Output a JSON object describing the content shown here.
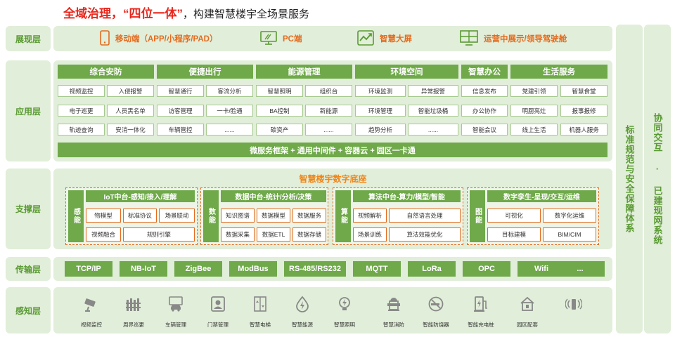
{
  "title": {
    "part1": "全域治理，“四位一体”",
    "part2": "，构建智慧楼宇全场景服务"
  },
  "layers": {
    "display": "展现层",
    "application": "应用层",
    "support": "支撑层",
    "transport": "传输层",
    "perception": "感知层"
  },
  "display": {
    "items": [
      {
        "label": "移动端（APP/小程序/PAD）",
        "icon": "mobile-phone-icon"
      },
      {
        "label": "PC端",
        "icon": "monitor-icon"
      },
      {
        "label": "智慧大屏",
        "icon": "trend-chart-icon"
      },
      {
        "label": "运营中展示/领导驾驶舱",
        "icon": "dashboard-grid-icon"
      }
    ]
  },
  "application": {
    "columns": [
      {
        "head": "综合安防",
        "cells": [
          "视频监控",
          "入侵报警",
          "电子巡更",
          "人员黑名单",
          "轨迹查询",
          "安消一体化"
        ]
      },
      {
        "head": "便捷出行",
        "cells": [
          "智慧通行",
          "客流分析",
          "访客管理",
          "一卡/脸通",
          "车辆管控",
          "......"
        ]
      },
      {
        "head": "能源管理",
        "cells": [
          "智慧照明",
          "组织台",
          "BA控制",
          "新能源",
          "碳资产",
          "......"
        ]
      },
      {
        "head": "环境空间",
        "cells": [
          "环境监测",
          "异常报警",
          "环境管理",
          "智能垃圾桶",
          "趋势分析",
          "......"
        ]
      },
      {
        "head": "智慧办公",
        "cells": [
          "信息发布",
          "办公协作",
          "智能会议"
        ]
      },
      {
        "head": "生活服务",
        "cells": [
          "党建引领",
          "智慧食堂",
          "明厨亮灶",
          "报事报修",
          "线上生活",
          "机器人服务"
        ]
      }
    ],
    "footer": "微服务框架 + 通用中间件 + 容器云 + 园区一卡通"
  },
  "support": {
    "title": "智慧楼宇数字底座",
    "blocks": [
      {
        "side": "感能",
        "head": "IoT中台-感知/接入/理解",
        "cells": [
          "物模型",
          "标准协议",
          "场景联动",
          "视频融合",
          "规则引擎"
        ]
      },
      {
        "side": "数能",
        "head": "数据中台-统计/分析/决策",
        "cells": [
          "知识图谱",
          "数据模型",
          "数据服务",
          "数据采集",
          "数据ETL",
          "数据存储"
        ]
      },
      {
        "side": "算能",
        "head": "算法中台-算力/模型/智能",
        "cells": [
          "视频解析",
          "自然语言处理",
          "场景训练",
          "算法效能优化"
        ]
      },
      {
        "side": "图能",
        "head": "数字孪生-呈现/交互/运维",
        "cells": [
          "可视化",
          "数字化运维",
          "目标建模",
          "BIM/CIM"
        ]
      }
    ]
  },
  "transport": {
    "items": [
      "TCP/IP",
      "NB-IoT",
      "ZigBee",
      "ModBus",
      "RS-485/RS232",
      "MQTT",
      "LoRa",
      "OPC",
      "Wifi",
      "..."
    ]
  },
  "perception": {
    "items": [
      {
        "label": "视频监控",
        "icon": "camera-icon"
      },
      {
        "label": "周界巡更",
        "icon": "fence-icon"
      },
      {
        "label": "车辆管理",
        "icon": "car-icon"
      },
      {
        "label": "门禁管理",
        "icon": "access-card-icon"
      },
      {
        "label": "智慧电梯",
        "icon": "elevator-icon"
      },
      {
        "label": "智慧能源",
        "icon": "energy-drop-icon"
      },
      {
        "label": "智慧照明",
        "icon": "bulb-icon"
      },
      {
        "label": "智慧消防",
        "icon": "hydrant-icon"
      },
      {
        "label": "智能防烧器",
        "icon": "no-smoking-icon"
      },
      {
        "label": "智能充电桩",
        "icon": "charging-pile-icon"
      },
      {
        "label": "园区配套",
        "icon": "home-icon"
      },
      {
        "label": "",
        "icon": "iot-sensor-icon"
      }
    ]
  },
  "side": {
    "col1": "标准规范与安全保障体系",
    "col2": "协同交互 · 已建现网系统"
  },
  "colors": {
    "accent_green": "#6fa94a",
    "panel_green": "#e1eed9",
    "orange": "#e46b1e",
    "red": "#e8261c"
  }
}
